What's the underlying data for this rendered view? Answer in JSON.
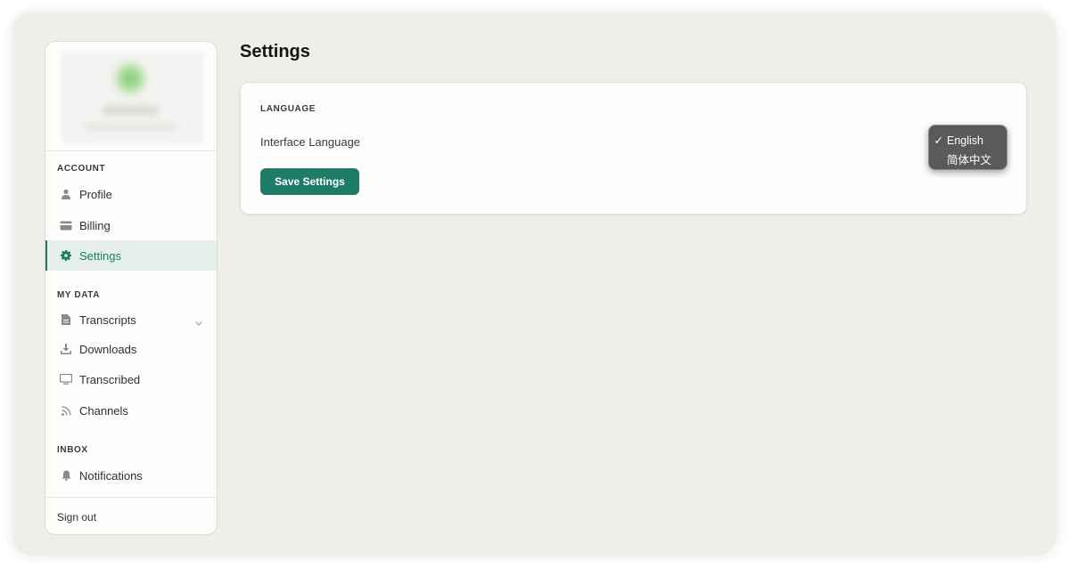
{
  "page": {
    "title": "Settings"
  },
  "sidebar": {
    "sections": [
      {
        "title": "ACCOUNT"
      },
      {
        "title": "MY DATA"
      },
      {
        "title": "INBOX"
      }
    ],
    "items": [
      {
        "label": "Profile",
        "icon": "user-icon"
      },
      {
        "label": "Billing",
        "icon": "credit-card-icon"
      },
      {
        "label": "Settings",
        "icon": "gear-icon",
        "active": true
      },
      {
        "label": "Transcripts",
        "icon": "document-icon",
        "expandable": true
      },
      {
        "label": "Downloads",
        "icon": "download-icon"
      },
      {
        "label": "Transcribed",
        "icon": "monitor-icon"
      },
      {
        "label": "Channels",
        "icon": "rss-icon"
      },
      {
        "label": "Notifications",
        "icon": "bell-icon"
      }
    ],
    "sign_out": "Sign out"
  },
  "settings": {
    "section_title": "LANGUAGE",
    "language_label": "Interface Language",
    "save_label": "Save Settings",
    "language_options": [
      {
        "label": "English",
        "selected": true,
        "check": "✓"
      },
      {
        "label": "简体中文",
        "selected": false,
        "check": ""
      }
    ]
  },
  "colors": {
    "accent": "#1e7c67",
    "background": "#efeee9",
    "card": "#fdfdfb",
    "active_bg": "#e6f0ea"
  }
}
